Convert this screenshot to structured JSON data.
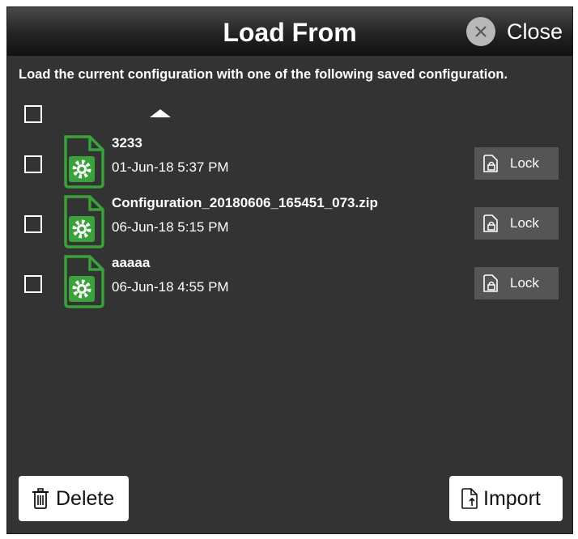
{
  "dialog": {
    "title": "Load From",
    "close_label": "Close",
    "instructions": "Load the current configuration with one of the following saved configuration.",
    "colors": {
      "accent_green": "#3aa23a",
      "background": "#333333",
      "button_gray": "#555555"
    }
  },
  "list": {
    "items": [
      {
        "name": "3233",
        "date": "01-Jun-18 5:37 PM",
        "lock_label": "Lock",
        "checked": false
      },
      {
        "name": "Configuration_20180606_165451_073.zip",
        "date": "06-Jun-18 5:15 PM",
        "lock_label": "Lock",
        "checked": false
      },
      {
        "name": "aaaaa",
        "date": "06-Jun-18 4:55 PM",
        "lock_label": "Lock",
        "checked": false
      }
    ],
    "icons": {
      "file": "config-file-icon",
      "lock": "lock-icon",
      "sort": "sort-ascending-icon"
    }
  },
  "footer": {
    "delete_label": "Delete",
    "import_label": "Import",
    "icons": {
      "delete": "trash-icon",
      "import": "import-file-icon"
    }
  }
}
